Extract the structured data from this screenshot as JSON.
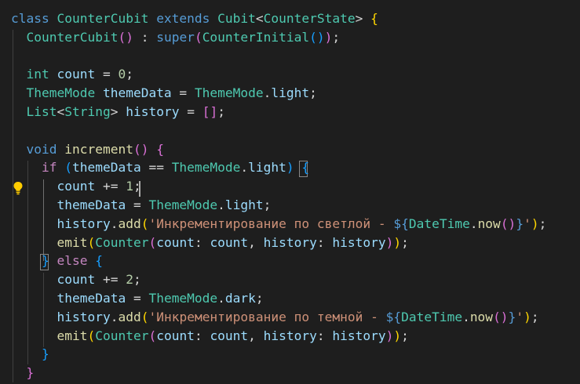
{
  "editor": {
    "lightbulb_color": "#ffcc00",
    "lines": [
      [
        [
          "k",
          "class"
        ],
        [
          "o",
          " "
        ],
        [
          "t",
          "CounterCubit"
        ],
        [
          "o",
          " "
        ],
        [
          "k",
          "extends"
        ],
        [
          "o",
          " "
        ],
        [
          "t",
          "Cubit"
        ],
        [
          "o",
          "<"
        ],
        [
          "t",
          "CounterState"
        ],
        [
          "o",
          "> "
        ],
        [
          "b1",
          "{"
        ]
      ],
      [
        [
          "o",
          "  "
        ],
        [
          "t",
          "CounterCubit"
        ],
        [
          "b2",
          "()"
        ],
        [
          "o",
          " : "
        ],
        [
          "k",
          "super"
        ],
        [
          "b2",
          "("
        ],
        [
          "t",
          "CounterInitial"
        ],
        [
          "b3",
          "()"
        ],
        [
          "b2",
          ")"
        ],
        [
          "o",
          ";"
        ]
      ],
      [],
      [
        [
          "o",
          "  "
        ],
        [
          "t",
          "int"
        ],
        [
          "o",
          " "
        ],
        [
          "v",
          "count"
        ],
        [
          "o",
          " = "
        ],
        [
          "n",
          "0"
        ],
        [
          "o",
          ";"
        ]
      ],
      [
        [
          "o",
          "  "
        ],
        [
          "t",
          "ThemeMode"
        ],
        [
          "o",
          " "
        ],
        [
          "v",
          "themeData"
        ],
        [
          "o",
          " = "
        ],
        [
          "t",
          "ThemeMode"
        ],
        [
          "o",
          "."
        ],
        [
          "v",
          "light"
        ],
        [
          "o",
          ";"
        ]
      ],
      [
        [
          "o",
          "  "
        ],
        [
          "t",
          "List"
        ],
        [
          "o",
          "<"
        ],
        [
          "t",
          "String"
        ],
        [
          "o",
          "> "
        ],
        [
          "v",
          "history"
        ],
        [
          "o",
          " = "
        ],
        [
          "b2",
          "[]"
        ],
        [
          "o",
          ";"
        ]
      ],
      [],
      [
        [
          "o",
          "  "
        ],
        [
          "k",
          "void"
        ],
        [
          "o",
          " "
        ],
        [
          "f",
          "increment"
        ],
        [
          "b2",
          "()"
        ],
        [
          "o",
          " "
        ],
        [
          "b2",
          "{"
        ]
      ],
      [
        [
          "o",
          "    "
        ],
        [
          "c",
          "if"
        ],
        [
          "o",
          " "
        ],
        [
          "b3",
          "("
        ],
        [
          "v",
          "themeData"
        ],
        [
          "o",
          " == "
        ],
        [
          "t",
          "ThemeMode"
        ],
        [
          "o",
          "."
        ],
        [
          "v",
          "light"
        ],
        [
          "b3",
          ")"
        ],
        [
          "o",
          " "
        ],
        [
          "b3",
          "{"
        ]
      ],
      [
        [
          "o",
          "      "
        ],
        [
          "v",
          "count"
        ],
        [
          "o",
          " += "
        ],
        [
          "n",
          "1"
        ],
        [
          "o",
          ";"
        ]
      ],
      [
        [
          "o",
          "      "
        ],
        [
          "v",
          "themeData"
        ],
        [
          "o",
          " = "
        ],
        [
          "t",
          "ThemeMode"
        ],
        [
          "o",
          "."
        ],
        [
          "v",
          "light"
        ],
        [
          "o",
          ";"
        ]
      ],
      [
        [
          "o",
          "      "
        ],
        [
          "v",
          "history"
        ],
        [
          "o",
          "."
        ],
        [
          "f",
          "add"
        ],
        [
          "b1",
          "("
        ],
        [
          "s",
          "'Инкрементирование по светлой - "
        ],
        [
          "k",
          "${"
        ],
        [
          "t",
          "DateTime"
        ],
        [
          "o",
          "."
        ],
        [
          "f",
          "now"
        ],
        [
          "b2",
          "()"
        ],
        [
          "k",
          "}"
        ],
        [
          "s",
          "'"
        ],
        [
          "b1",
          ")"
        ],
        [
          "o",
          ";"
        ]
      ],
      [
        [
          "o",
          "      "
        ],
        [
          "f",
          "emit"
        ],
        [
          "b1",
          "("
        ],
        [
          "t",
          "Counter"
        ],
        [
          "b2",
          "("
        ],
        [
          "v",
          "count"
        ],
        [
          "o",
          ": "
        ],
        [
          "v",
          "count"
        ],
        [
          "o",
          ", "
        ],
        [
          "v",
          "history"
        ],
        [
          "o",
          ": "
        ],
        [
          "v",
          "history"
        ],
        [
          "b2",
          ")"
        ],
        [
          "b1",
          ")"
        ],
        [
          "o",
          ";"
        ]
      ],
      [
        [
          "o",
          "    "
        ],
        [
          "b3",
          "}"
        ],
        [
          "o",
          " "
        ],
        [
          "c",
          "else"
        ],
        [
          "o",
          " "
        ],
        [
          "b3",
          "{"
        ]
      ],
      [
        [
          "o",
          "      "
        ],
        [
          "v",
          "count"
        ],
        [
          "o",
          " += "
        ],
        [
          "n",
          "2"
        ],
        [
          "o",
          ";"
        ]
      ],
      [
        [
          "o",
          "      "
        ],
        [
          "v",
          "themeData"
        ],
        [
          "o",
          " = "
        ],
        [
          "t",
          "ThemeMode"
        ],
        [
          "o",
          "."
        ],
        [
          "v",
          "dark"
        ],
        [
          "o",
          ";"
        ]
      ],
      [
        [
          "o",
          "      "
        ],
        [
          "v",
          "history"
        ],
        [
          "o",
          "."
        ],
        [
          "f",
          "add"
        ],
        [
          "b1",
          "("
        ],
        [
          "s",
          "'Инкрементирование по темной - "
        ],
        [
          "k",
          "${"
        ],
        [
          "t",
          "DateTime"
        ],
        [
          "o",
          "."
        ],
        [
          "f",
          "now"
        ],
        [
          "b2",
          "()"
        ],
        [
          "k",
          "}"
        ],
        [
          "s",
          "'"
        ],
        [
          "b1",
          ")"
        ],
        [
          "o",
          ";"
        ]
      ],
      [
        [
          "o",
          "      "
        ],
        [
          "f",
          "emit"
        ],
        [
          "b1",
          "("
        ],
        [
          "t",
          "Counter"
        ],
        [
          "b2",
          "("
        ],
        [
          "v",
          "count"
        ],
        [
          "o",
          ": "
        ],
        [
          "v",
          "count"
        ],
        [
          "o",
          ", "
        ],
        [
          "v",
          "history"
        ],
        [
          "o",
          ": "
        ],
        [
          "v",
          "history"
        ],
        [
          "b2",
          ")"
        ],
        [
          "b1",
          ")"
        ],
        [
          "o",
          ";"
        ]
      ],
      [
        [
          "o",
          "    "
        ],
        [
          "b3",
          "}"
        ]
      ],
      [
        [
          "o",
          "  "
        ],
        [
          "b2",
          "}"
        ]
      ]
    ]
  }
}
